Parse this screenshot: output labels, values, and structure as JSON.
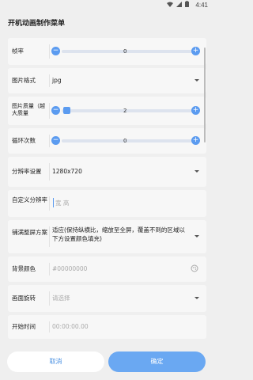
{
  "status": {
    "time": "4:41",
    "icons": [
      "wifi-icon",
      "signal-icon",
      "battery-icon"
    ]
  },
  "title": "开机动画制作菜单",
  "rows": {
    "fps": {
      "label": "帧率",
      "minus": "−",
      "plus": "+",
      "value": "0"
    },
    "format": {
      "label": "图片格式",
      "value": "jpg"
    },
    "quality": {
      "label": "图片质量（越大质量",
      "minus": "−",
      "plus": "+",
      "value": "2"
    },
    "loops": {
      "label": "循环次数",
      "minus": "−",
      "plus": "+",
      "value": "0"
    },
    "resolution": {
      "label": "分辨率设置",
      "value": "1280x720"
    },
    "custom_res": {
      "label": "自定义分辨率",
      "value": "宽  高"
    },
    "scale": {
      "label": "铺满整屏方案",
      "value": "适应(保持纵横比，缩放至全屏，覆盖不到的区域以下方设置颜色填充)"
    },
    "bgcolor": {
      "label": "背景颜色",
      "placeholder": "#00000000"
    },
    "rotate": {
      "label": "画面旋转",
      "placeholder": "请选择"
    },
    "start_time": {
      "label": "开始时间",
      "placeholder": "00:00:00.00"
    }
  },
  "buttons": {
    "cancel": "取消",
    "ok": "确定"
  },
  "colors": {
    "accent": "#5b9bf0",
    "ok_bg": "#6aa8f2"
  }
}
